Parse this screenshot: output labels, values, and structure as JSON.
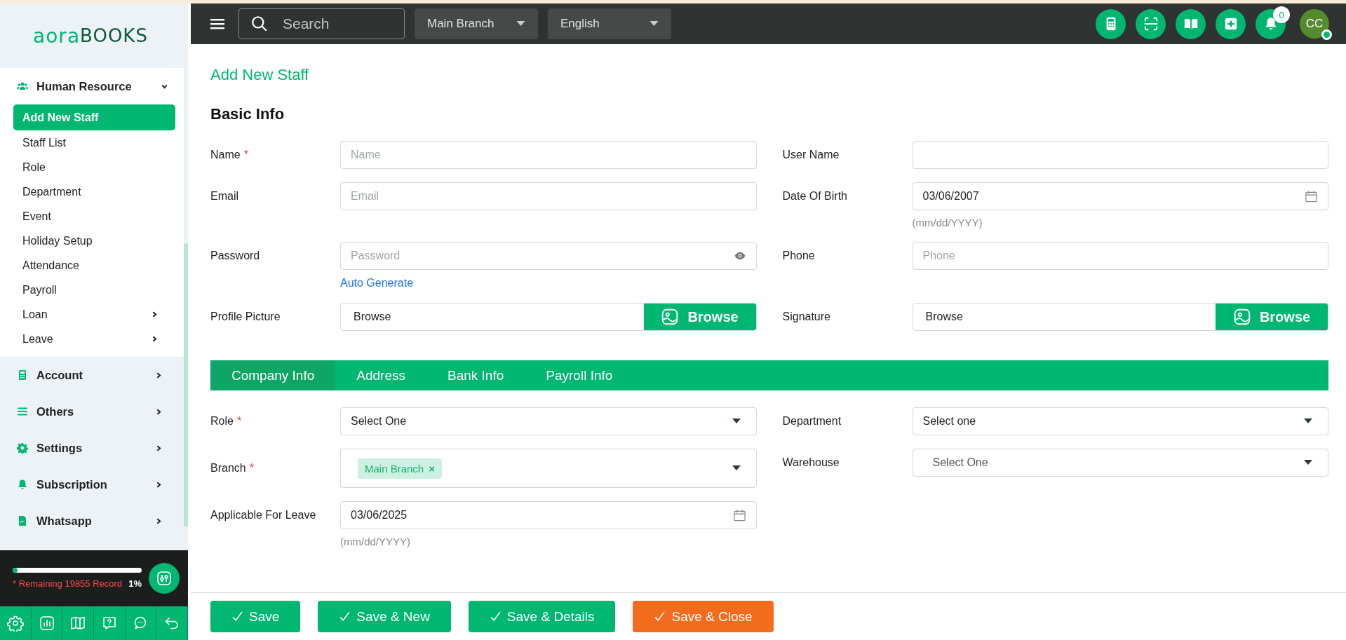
{
  "topbar": {
    "search": {
      "placeholder": "Search"
    },
    "branch_select": {
      "value": "Main Branch"
    },
    "language_select": {
      "value": "English"
    },
    "notification_count": "0",
    "avatar": {
      "initials": "CC",
      "online": true
    }
  },
  "sidebar": {
    "logo": {
      "first": "aora",
      "second": "BOOKS"
    },
    "groups": [
      {
        "label": "Human Resource",
        "expanded": true,
        "items": [
          {
            "label": "Add New Staff",
            "selected": true,
            "has_submenu": false
          },
          {
            "label": "Staff List",
            "selected": false,
            "has_submenu": false
          },
          {
            "label": "Role",
            "selected": false,
            "has_submenu": false
          },
          {
            "label": "Department",
            "selected": false,
            "has_submenu": false
          },
          {
            "label": "Event",
            "selected": false,
            "has_submenu": false
          },
          {
            "label": "Holiday Setup",
            "selected": false,
            "has_submenu": false
          },
          {
            "label": "Attendance",
            "selected": false,
            "has_submenu": false
          },
          {
            "label": "Payroll",
            "selected": false,
            "has_submenu": false
          },
          {
            "label": "Loan",
            "selected": false,
            "has_submenu": true
          },
          {
            "label": "Leave",
            "selected": false,
            "has_submenu": true
          }
        ]
      },
      {
        "label": "Account",
        "expanded": false
      },
      {
        "label": "Others",
        "expanded": false
      },
      {
        "label": "Settings",
        "expanded": false
      },
      {
        "label": "Subscription",
        "expanded": false
      },
      {
        "label": "Whatsapp",
        "expanded": false
      }
    ],
    "usage": {
      "level": 0.04,
      "remaining": "* Remaining 19855 Record",
      "percent": "1%"
    }
  },
  "page": {
    "title": "Add New Staff",
    "section": "Basic Info",
    "basic_fields": [
      {
        "label": "Name",
        "required_mark": "*",
        "kind": "text",
        "placeholder": "Name"
      },
      {
        "label": "User Name",
        "kind": "text"
      },
      {
        "label": "Email",
        "kind": "text",
        "placeholder": "Email"
      },
      {
        "label": "Date Of Birth",
        "kind": "date",
        "value": "03/06/2007",
        "hint": "(mm/dd/YYYY)"
      },
      {
        "label": "Password",
        "kind": "password",
        "placeholder": "Password",
        "link": "Auto Generate"
      },
      {
        "label": "Phone",
        "kind": "text",
        "placeholder": "Phone"
      },
      {
        "label": "Profile Picture",
        "kind": "file",
        "value": "Browse",
        "button": "Browse"
      },
      {
        "label": "Signature",
        "kind": "file",
        "value": "Browse",
        "button": "Browse"
      }
    ],
    "tabs": [
      {
        "label": "Company Info",
        "selected": true
      },
      {
        "label": "Address",
        "selected": false
      },
      {
        "label": "Bank Info",
        "selected": false
      },
      {
        "label": "Payroll Info",
        "selected": false
      }
    ],
    "company_fields": [
      {
        "label": "Role",
        "required_mark": "*",
        "kind": "select",
        "value": "Select One"
      },
      {
        "label": "Department",
        "kind": "select",
        "value": "Select one"
      },
      {
        "label": "Branch",
        "required_mark": "*",
        "kind": "tags",
        "tags": [
          {
            "label": "Main Branch",
            "remove": "×"
          }
        ]
      },
      {
        "label": "Warehouse",
        "kind": "select",
        "value": "Select One"
      },
      {
        "label": "Applicable For Leave",
        "kind": "date",
        "value": "03/06/2025",
        "hint": "(mm/dd/YYYY)"
      }
    ]
  },
  "actions": [
    {
      "label": "Save",
      "kind": "primary"
    },
    {
      "label": "Save & New",
      "kind": "primary"
    },
    {
      "label": "Save & Details",
      "kind": "primary"
    },
    {
      "label": "Save & Close",
      "kind": "warning"
    }
  ]
}
